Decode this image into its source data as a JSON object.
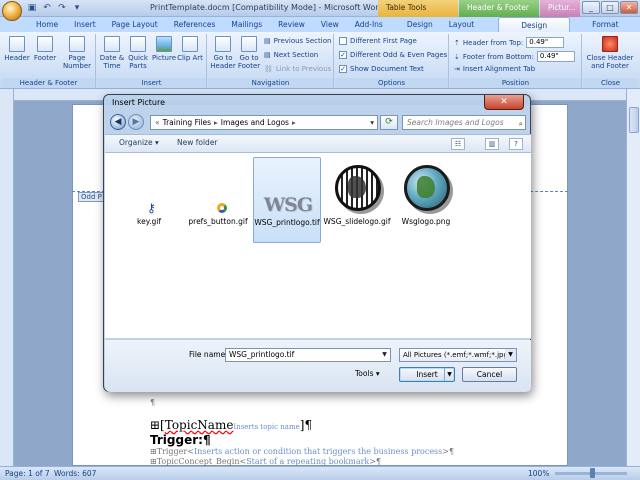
{
  "window": {
    "title": "PrintTemplate.docm [Compatibility Mode] - Microsoft Word",
    "context_tabs": [
      "Table Tools",
      "Header & Footer Tools",
      "Pictur..."
    ]
  },
  "ribbon": {
    "tabs": [
      "Home",
      "Insert",
      "Page Layout",
      "References",
      "Mailings",
      "Review",
      "View",
      "Add-Ins",
      "Design",
      "Layout",
      "Design",
      "Format"
    ],
    "groups": {
      "header_footer": {
        "label": "Header & Footer",
        "buttons": [
          "Header",
          "Footer",
          "Page Number"
        ]
      },
      "insert": {
        "label": "Insert",
        "buttons": [
          "Date & Time",
          "Quick Parts",
          "Picture",
          "Clip Art"
        ]
      },
      "navigation": {
        "label": "Navigation",
        "buttons": [
          "Go to Header",
          "Go to Footer"
        ],
        "small": [
          "Previous Section",
          "Next Section",
          "Link to Previous"
        ]
      },
      "options": {
        "label": "Options",
        "checks": [
          {
            "label": "Different First Page",
            "checked": false
          },
          {
            "label": "Different Odd & Even Pages",
            "checked": true
          },
          {
            "label": "Show Document Text",
            "checked": true
          }
        ]
      },
      "position": {
        "label": "Position",
        "header_from_top_label": "Header from Top:",
        "header_from_top": "0.49\"",
        "footer_from_bottom_label": "Footer from Bottom:",
        "footer_from_bottom": "0.49\"",
        "align_tab": "Insert Alignment Tab"
      },
      "close": {
        "label": "Close",
        "button": "Close Header and Footer"
      }
    }
  },
  "document": {
    "header_tag": "Odd P",
    "lines": {
      "topic_name": "TopicName",
      "topic_name_tag": "Inserts topic name",
      "trigger_heading": "Trigger:",
      "trigger": "Trigger",
      "trigger_tag": "Inserts action or condition that triggers the business process",
      "topic_concept": "TopicConcept_Begin",
      "topic_concept_tag": "Start of a repeating bookmark"
    }
  },
  "dialog": {
    "title": "Insert Picture",
    "breadcrumb": [
      "Training Files",
      "Images and Logos"
    ],
    "search_placeholder": "Search Images and Logos",
    "toolbar": {
      "organize": "Organize ▾",
      "new_folder": "New folder"
    },
    "files": [
      {
        "name": "key.gif",
        "selected": false
      },
      {
        "name": "prefs_button.gif",
        "selected": false
      },
      {
        "name": "WSG_printlogo.tif",
        "selected": true
      },
      {
        "name": "WSG_slidelogo.gif",
        "selected": false
      },
      {
        "name": "Wsglogo.png",
        "selected": false
      }
    ],
    "wsg_logo_text": "WSG",
    "file_name_label": "File name:",
    "file_name_value": "WSG_printlogo.tif",
    "file_type": "All Pictures (*.emf;*.wmf;*.jpg;*",
    "tools_label": "Tools",
    "insert_label": "Insert",
    "cancel_label": "Cancel"
  },
  "status": {
    "page": "Page: 1 of 7",
    "words": "Words: 607",
    "zoom": "100%"
  }
}
